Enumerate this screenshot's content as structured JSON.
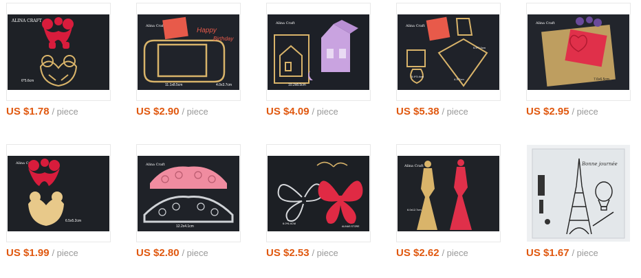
{
  "products": [
    {
      "price": "US $1.78",
      "unit": "/ piece",
      "brand": "ALINA CRAFT",
      "size": "6*5.6cm",
      "bg": "#1e2126"
    },
    {
      "price": "US $2.90",
      "unit": "/ piece",
      "brand": "Alina Craft",
      "size": "11.1x8.5cm",
      "size2": "4.0x3.7cm",
      "bg": "#20232a"
    },
    {
      "price": "US $4.09",
      "unit": "/ piece",
      "brand": "Alina Craft",
      "size": "10.2x8.5cm",
      "bg": "#1d2027"
    },
    {
      "price": "US $5.38",
      "unit": "/ piece",
      "brand": "Alina Craft",
      "size": "5.4*3.4cm",
      "size2": "4.3*7cm",
      "size3": "5.5*7.0cm",
      "bg": "#1f2229"
    },
    {
      "price": "US $2.95",
      "unit": "/ piece",
      "brand": "Alina Craft",
      "size": "7.6x6.5cm",
      "bg": "#22252c"
    },
    {
      "price": "US $1.99",
      "unit": "/ piece",
      "brand": "Alina Craft",
      "size": "6.5x5.2cm",
      "bg": "#1e2126"
    },
    {
      "price": "US $2.80",
      "unit": "/ piece",
      "brand": "Alina Craft",
      "size": "12.2x4.1cm",
      "bg": "#1f2228"
    },
    {
      "price": "US $2.53",
      "unit": "/ piece",
      "brand": "ALINAS STORE",
      "size": "6.0*6.4CM",
      "bg": "#1c1f24"
    },
    {
      "price": "US $2.62",
      "unit": "/ piece",
      "brand": "Alina Craft",
      "size": "6.0x12.7cm",
      "bg": "#1f2227"
    },
    {
      "price": "US $1.67",
      "unit": "/ piece",
      "stamp_text": "Bonne journée",
      "bg": "#dfe3e6"
    }
  ]
}
